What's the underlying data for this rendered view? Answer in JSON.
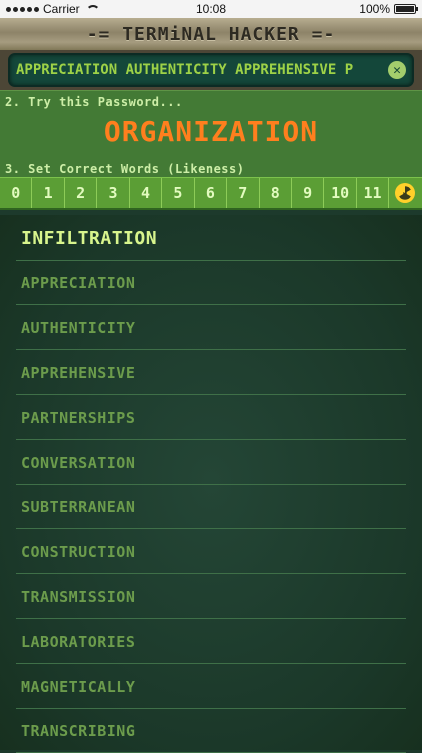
{
  "status_bar": {
    "carrier": "Carrier",
    "time": "10:08",
    "battery": "100%"
  },
  "header": {
    "title": "-= TERMiNAL HACKER =-"
  },
  "words_entry": {
    "text": "APPRECIATION AUTHENTICITY APPREHENSIVE P",
    "clear_icon": "clear-x-icon"
  },
  "password_step": {
    "label": "2. Try this Password...",
    "password": "ORGANIZATION",
    "password_color": "#ff7f1e"
  },
  "likeness_step": {
    "label": "3. Set Correct Words (Likeness)",
    "options": [
      "0",
      "1",
      "2",
      "3",
      "4",
      "5",
      "6",
      "7",
      "8",
      "9",
      "10",
      "11"
    ],
    "extra_icon": "radiation-icon"
  },
  "word_list": [
    "INFILTRATION",
    "APPRECIATION",
    "AUTHENTICITY",
    "APPREHENSIVE",
    "PARTNERSHIPS",
    "CONVERSATION",
    "SUBTERRANEAN",
    "CONSTRUCTION",
    "TRANSMISSION",
    "LABORATORIES",
    "MAGNETICALLY",
    "TRANSCRIBING"
  ],
  "colors": {
    "accent_green": "#5b9e35",
    "highlight_text": "#d8f58d"
  }
}
